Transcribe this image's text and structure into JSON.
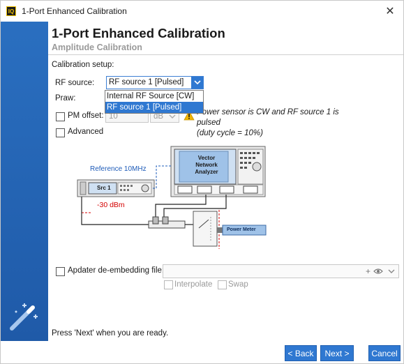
{
  "window": {
    "app_icon_text": "IQ",
    "title": "1-Port Enhanced Calibration",
    "close_glyph": "✕"
  },
  "header": {
    "title": "1-Port Enhanced Calibration",
    "subtitle": "Amplitude Calibration"
  },
  "setup": {
    "section_label": "Calibration setup:",
    "rf_source_label": "RF source:",
    "rf_source_value": "RF source 1 [Pulsed]",
    "rf_source_options": [
      "Internal RF Source [CW]",
      "RF source 1 [Pulsed]"
    ],
    "rf_source_selected_index": 1,
    "praw_label": "Praw:",
    "pm_offset_label": "PM offset:",
    "pm_offset_value": "10",
    "pm_offset_unit": "dB",
    "note_line1": "Power sensor is CW and RF source 1 is pulsed",
    "note_line2": "(duty cycle = 10%)",
    "advanced_label": "Advanced"
  },
  "diagram": {
    "vna_label_line1": "Vector",
    "vna_label_line2": "Network",
    "vna_label_line3": "Analyzer",
    "reference_label": "Reference 10MHz",
    "src_label": "Src 1",
    "level_label": "-30 dBm",
    "power_meter_label": "Power Meter"
  },
  "apdater": {
    "label": "Apdater de-embedding file:",
    "value": "",
    "interpolate_label": "Interpolate",
    "swap_label": "Swap"
  },
  "status_text": "Press 'Next' when you are ready.",
  "buttons": {
    "back": "< Back",
    "next": "Next >",
    "cancel": "Cancel"
  },
  "colors": {
    "accent": "#2f78d1",
    "sidebar": "#2366b8",
    "warning": "#f0b400",
    "level_red": "#d40000",
    "ref_blue": "#1e5bb8"
  }
}
